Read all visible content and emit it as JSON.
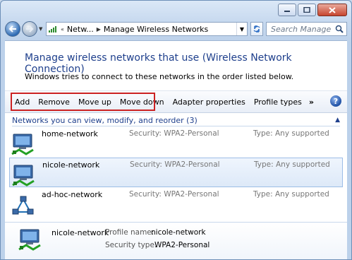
{
  "address": {
    "segments": [
      "Netw...",
      "Manage Wireless Networks"
    ]
  },
  "search": {
    "placeholder": "Search Manage Wireless..."
  },
  "page": {
    "title": "Manage wireless networks that use (Wireless Network Connection)",
    "subtitle": "Windows tries to connect to these networks in the order listed below."
  },
  "toolbar": {
    "add": "Add",
    "remove": "Remove",
    "move_up": "Move up",
    "move_down": "Move down",
    "adapter_properties": "Adapter properties",
    "profile_types": "Profile types",
    "more": "»",
    "help": "?"
  },
  "group": {
    "header": "Networks you can view, modify, and reorder (3)"
  },
  "networks": [
    {
      "name": "home-network",
      "security": "Security:  WPA2-Personal",
      "type": "Type:  Any supported",
      "icon": "wireless-network-icon"
    },
    {
      "name": "nicole-network",
      "security": "Security:  WPA2-Personal",
      "type": "Type:  Any supported",
      "icon": "wireless-network-icon"
    },
    {
      "name": "ad-hoc-network",
      "security": "Security:  WPA2-Personal",
      "type": "Type:  Any supported",
      "icon": "adhoc-network-icon"
    }
  ],
  "details": {
    "name": "nicole-network",
    "profile_label": "Profile name:",
    "profile_value": "nicole-network",
    "security_label": "Security type:",
    "security_value": "WPA2-Personal"
  }
}
